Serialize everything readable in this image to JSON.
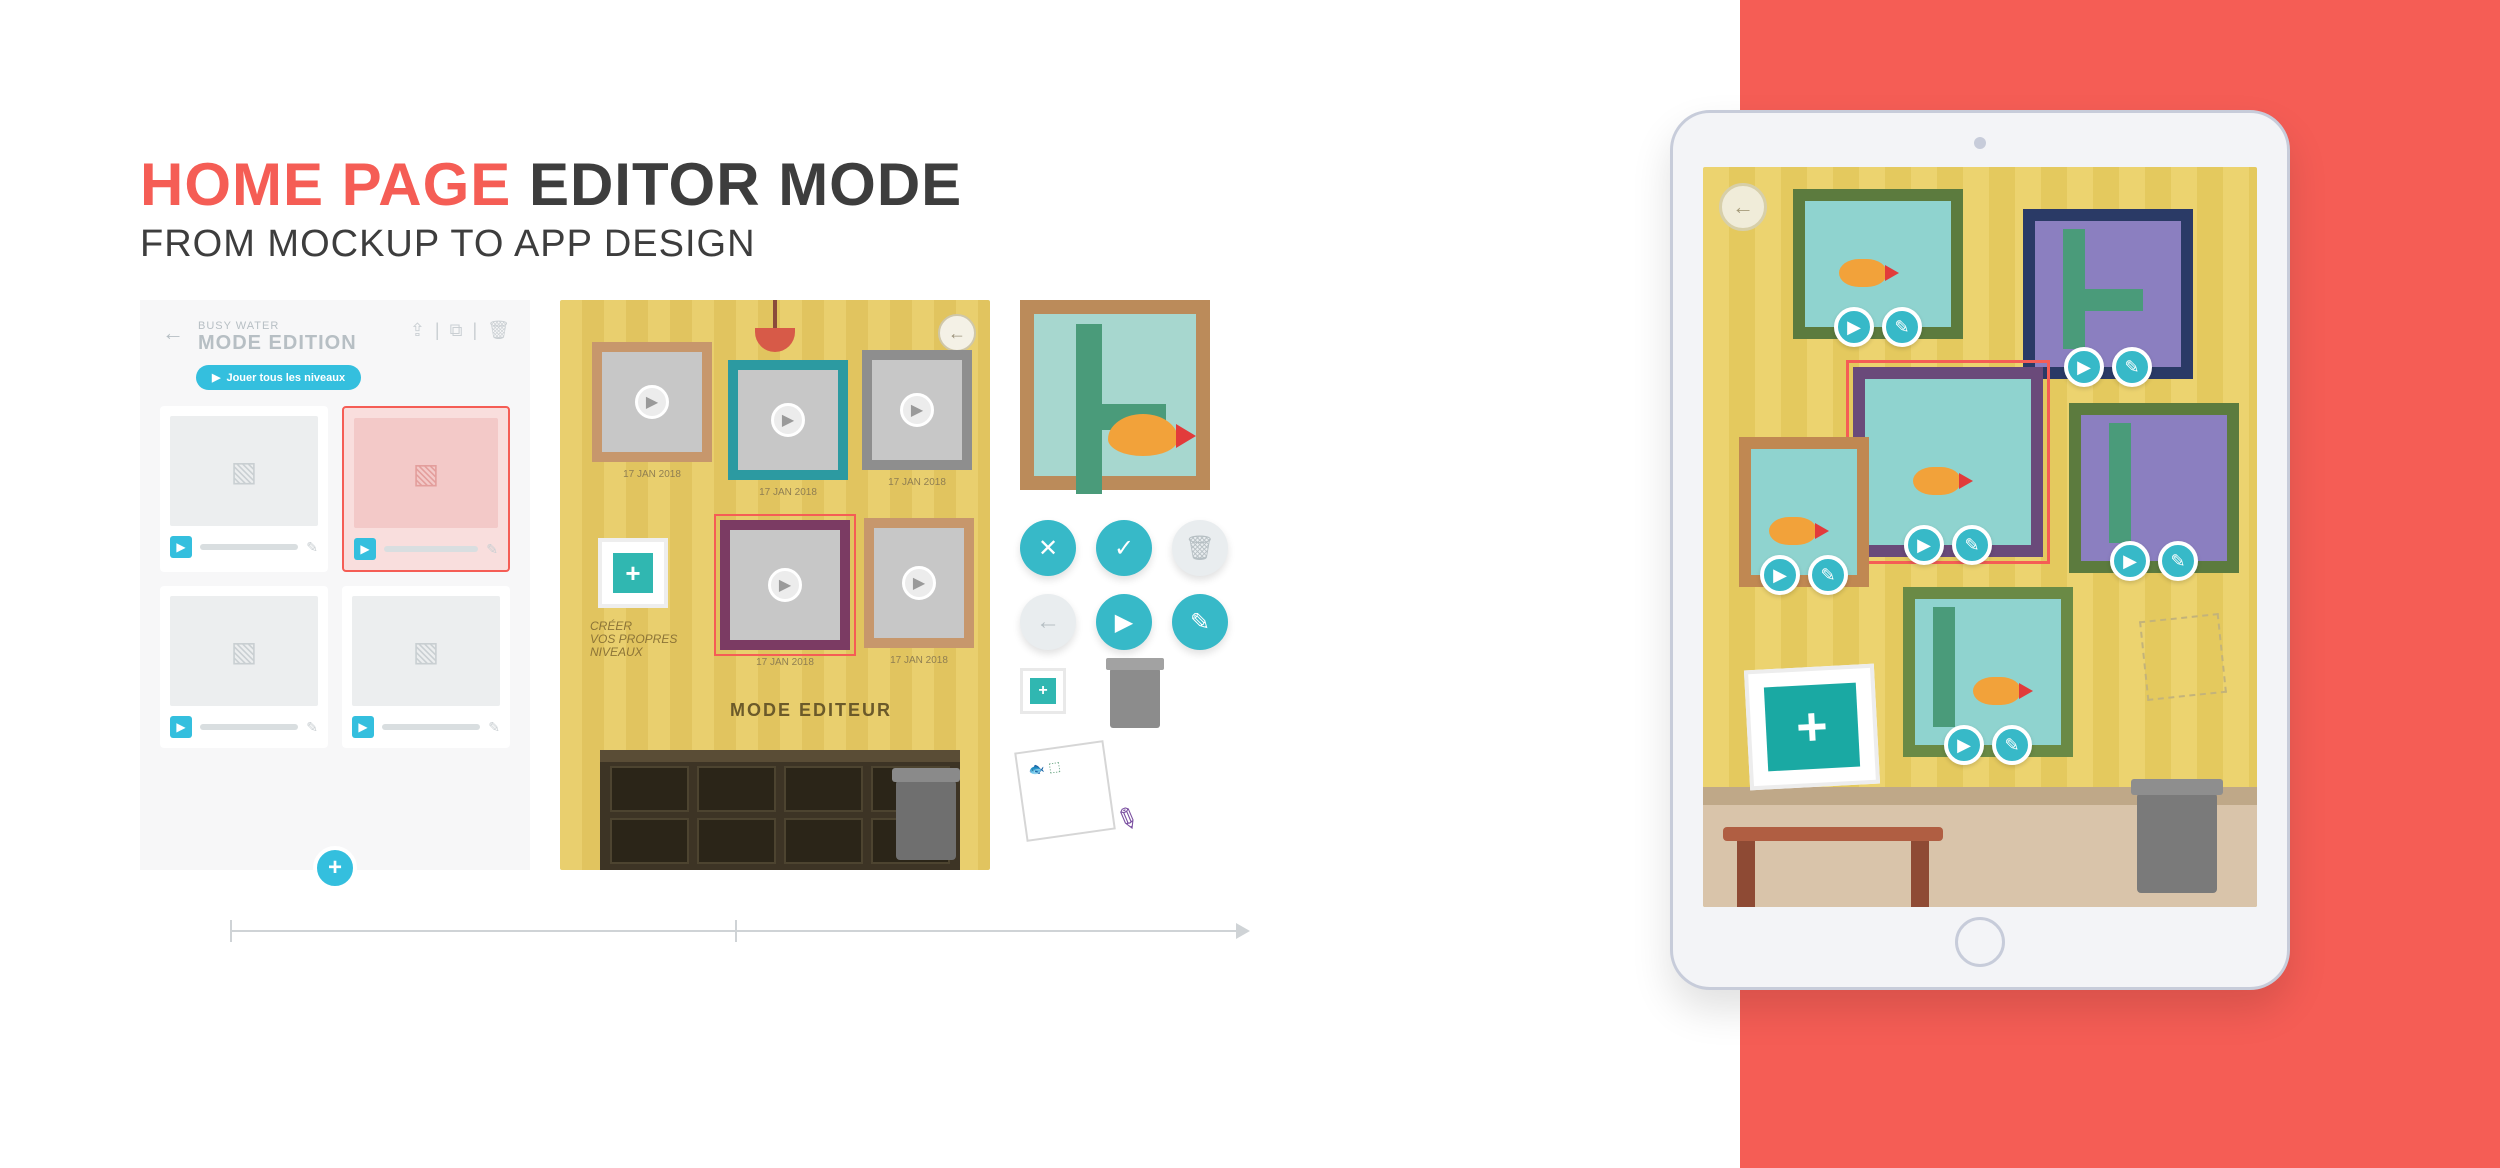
{
  "header": {
    "title_accent": "HOME PAGE",
    "title_plain": "EDITOR MODE",
    "subtitle": "FROM MOCKUP TO APP DESIGN"
  },
  "wireframe": {
    "kicker": "BUSY WATER",
    "mode": "MODE EDITION",
    "play_all": "Jouer tous les niveaux"
  },
  "paint": {
    "note_line1": "CRÉER",
    "note_line2": "VOS PROPRES",
    "note_line3": "NIVEAUX",
    "shelf_label": "MODE EDITEUR",
    "frame_dates": [
      "17 JAN 2018",
      "17 JAN 2018",
      "17 JAN 2018",
      "17 JAN 2018",
      "17 JAN 2018"
    ]
  },
  "icons": {
    "play": "▶",
    "edit": "✎",
    "close": "✕",
    "check": "✓",
    "trash": "🗑",
    "back": "←",
    "plus": "+"
  },
  "colors": {
    "accent": "#f55d55",
    "teal": "#34bfde",
    "wall": "#e9cf6e"
  }
}
